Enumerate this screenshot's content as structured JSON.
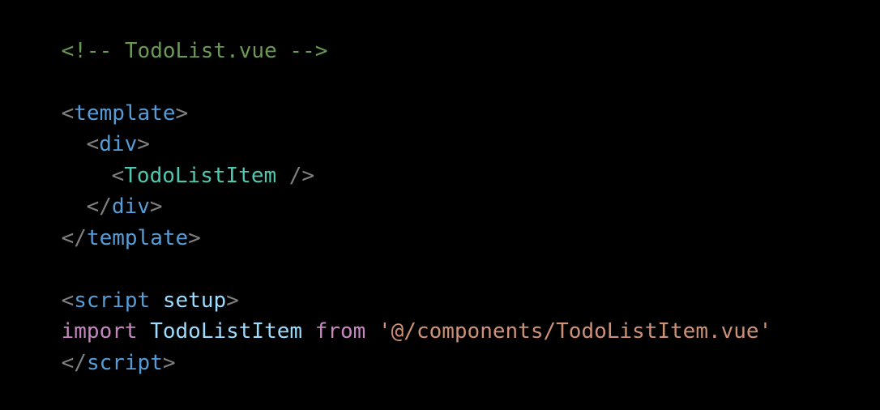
{
  "editor": {
    "language": "vue",
    "colors": {
      "background": "#000000",
      "comment": "#6a9955",
      "bracket": "#808080",
      "tag": "#569cd6",
      "component": "#4ec9b0",
      "attribute": "#9cdcfe",
      "keyword": "#c586c0",
      "string": "#ce9178"
    },
    "lines": {
      "l1": {
        "comment": "<!-- TodoList.vue -->"
      },
      "l3": {
        "open": "<",
        "tag": "template",
        "close": ">"
      },
      "l4": {
        "open": "<",
        "tag": "div",
        "close": ">"
      },
      "l5": {
        "open": "<",
        "component": "TodoListItem",
        "close": " />"
      },
      "l6": {
        "open": "</",
        "tag": "div",
        "close": ">"
      },
      "l7": {
        "open": "</",
        "tag": "template",
        "close": ">"
      },
      "l9": {
        "open": "<",
        "tag": "script",
        "space": " ",
        "attr": "setup",
        "close": ">"
      },
      "l10": {
        "keyword_import": "import",
        "ident": "TodoListItem",
        "keyword_from": "from",
        "string": "'@/components/TodoListItem.vue'"
      },
      "l11": {
        "open": "</",
        "tag": "script",
        "close": ">"
      }
    }
  }
}
